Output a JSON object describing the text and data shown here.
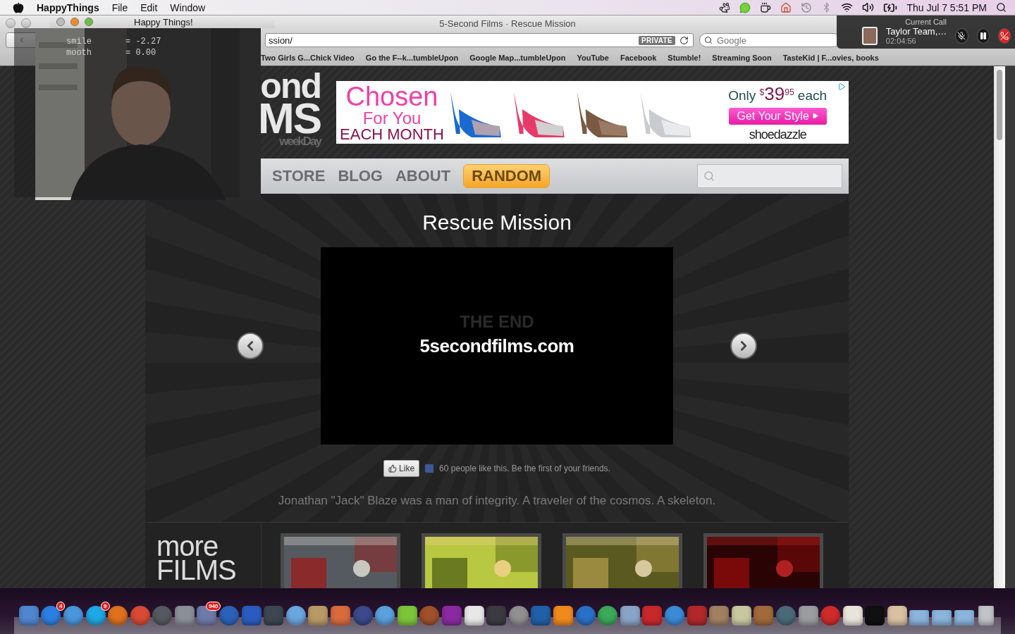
{
  "menu_bar": {
    "app_name": "HappyThings",
    "menus": [
      "File",
      "Edit",
      "Window"
    ],
    "clock": "Thu Jul 7  5:51 PM"
  },
  "browser": {
    "title": "5-Second Films · Rescue Mission",
    "url": "ssion/",
    "private_badge": "PRIVATE",
    "search": {
      "placeholder": "Google"
    },
    "bookmarks": [
      "Two Girls G...Chick Video",
      "Go the F--k...tumbleUpon",
      "Google Map...tumbleUpon",
      "YouTube",
      "Facebook",
      "Stumble!",
      "Streaming Soon",
      "TasteKid | F...ovies, books"
    ]
  },
  "site": {
    "logo": [
      "ond",
      "MS",
      "weekDay"
    ],
    "ad": {
      "headline": [
        "Chosen",
        "For You",
        "EACH MONTH"
      ],
      "price_prefix": "Only",
      "currency": "$",
      "price": "39",
      "cents": "95",
      "price_suffix": "each",
      "button": "Get Your Style",
      "brand": "shoedazzle"
    },
    "nav": [
      {
        "label": "STORE",
        "kind": "link"
      },
      {
        "label": "BLOG",
        "kind": "link"
      },
      {
        "label": "ABOUT",
        "kind": "link"
      },
      {
        "label": "RANDOM",
        "kind": "button"
      }
    ]
  },
  "film": {
    "title": "Rescue Mission",
    "ghost_text": "THE END",
    "video_text": "5secondfilms.com",
    "like_button": "Like",
    "like_text": "60 people like this. Be the first of your friends.",
    "description": "Jonathan \"Jack\" Blaze was a man of integrity. A traveler of the cosmos. A skeleton."
  },
  "more_films": {
    "heading": [
      "more",
      "FILMS"
    ],
    "thumbnails": [
      {
        "kind": "picture"
      },
      {
        "kind": "picture"
      },
      {
        "kind": "picture"
      },
      {
        "kind": "picture"
      }
    ]
  },
  "webcam_window": {
    "title": "Happy Things!",
    "readouts": [
      {
        "label": "smile",
        "value": "= -2.27"
      },
      {
        "label": "mooth",
        "value": "= 0.00"
      }
    ]
  },
  "call": {
    "header": "Current Call",
    "name": "Taylor Team,…",
    "duration": "02:04:56"
  },
  "dock": {
    "items": [
      {
        "kind": "square",
        "color": "#4f86d0"
      },
      {
        "kind": "round",
        "color": "#2c7fe0",
        "badge": "4"
      },
      {
        "kind": "round",
        "color": "#4a96dc"
      },
      {
        "kind": "round",
        "color": "#1ea8e6",
        "badge": "9"
      },
      {
        "kind": "round",
        "color": "#e0701c"
      },
      {
        "kind": "round",
        "color": "#d84a34"
      },
      {
        "kind": "round",
        "color": "#555a60"
      },
      {
        "kind": "square",
        "color": "#8a8f98"
      },
      {
        "kind": "square",
        "color": "#6d7aa8",
        "badge": "940"
      },
      {
        "kind": "round",
        "color": "#2a62b8"
      },
      {
        "kind": "square",
        "color": "#2a5cc0"
      },
      {
        "kind": "square",
        "color": "#3c4650"
      },
      {
        "kind": "round",
        "color": "#6aa6e0"
      },
      {
        "kind": "square",
        "color": "#b89a66"
      },
      {
        "kind": "square",
        "color": "#d86a3c"
      },
      {
        "kind": "round",
        "color": "#3a4a8a"
      },
      {
        "kind": "round",
        "color": "#5aa0dc"
      },
      {
        "kind": "square",
        "color": "#7cc43a"
      },
      {
        "kind": "round",
        "color": "#a0502a"
      },
      {
        "kind": "square",
        "color": "#8a2aa0"
      },
      {
        "kind": "square",
        "color": "#e8e8e8"
      },
      {
        "kind": "square",
        "color": "#3a3a40"
      },
      {
        "kind": "round",
        "color": "#909090"
      },
      {
        "kind": "square",
        "color": "#2060a8"
      },
      {
        "kind": "square",
        "color": "#f08a1c"
      },
      {
        "kind": "round",
        "color": "#2a70c8"
      },
      {
        "kind": "round",
        "color": "#3ca85a"
      },
      {
        "kind": "square",
        "color": "#8aa4c8"
      },
      {
        "kind": "square",
        "color": "#c8282a"
      },
      {
        "kind": "round",
        "color": "#3a8ad8"
      },
      {
        "kind": "square",
        "color": "#b02828"
      },
      {
        "kind": "square",
        "color": "#a08060"
      },
      {
        "kind": "square",
        "color": "#c8c8a0"
      },
      {
        "kind": "square",
        "color": "#a06a3a"
      },
      {
        "kind": "round",
        "color": "#4a6a7a"
      },
      {
        "kind": "square",
        "color": "#9a9ca0"
      },
      {
        "kind": "round",
        "color": "#d02a2a"
      },
      {
        "kind": "square",
        "color": "#e8e4dc"
      },
      {
        "kind": "square",
        "color": "#101010"
      },
      {
        "kind": "square",
        "color": "#d8c0a0"
      },
      {
        "kind": "folder",
        "color": "#8ab4dc"
      },
      {
        "kind": "folder",
        "color": "#8ab4dc"
      },
      {
        "kind": "folder",
        "color": "#8ab4dc"
      },
      {
        "kind": "trash",
        "color": "#c0c4c8"
      }
    ]
  }
}
